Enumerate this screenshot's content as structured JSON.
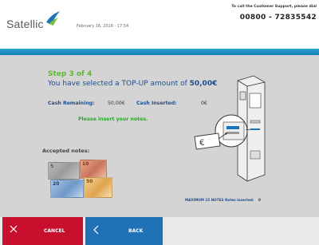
{
  "header": {
    "brand": "Satellic",
    "date": "February 16, 2016 · 17:54",
    "support_label": "To call the Customer Support, please dial",
    "support_phone": "00800 - 72835542"
  },
  "main": {
    "step": "Step 3 of 4",
    "selected_prefix": "You have selected a TOP-UP amount of ",
    "selected_amount": "50,00€",
    "cash_remaining_label": "Cash Remaining:",
    "cash_remaining_value": "50,00€",
    "cash_inserted_label": "Cash Inserted:",
    "cash_inserted_value": "0€",
    "instruction": "Please insert your notes.",
    "accepted_label": "Accepted notes:",
    "notes": [
      "5",
      "10",
      "20",
      "50"
    ],
    "max_notes_label": "MAXIMUM 15 NOTES",
    "notes_inserted_label": "Notes inserted:",
    "notes_inserted_value": "0"
  },
  "footer": {
    "cancel_label": "CANCEL",
    "back_label": "BACK"
  },
  "colors": {
    "brand_blue": "#1e72b5",
    "cancel_red": "#c8102e",
    "step_green": "#5fb830"
  }
}
